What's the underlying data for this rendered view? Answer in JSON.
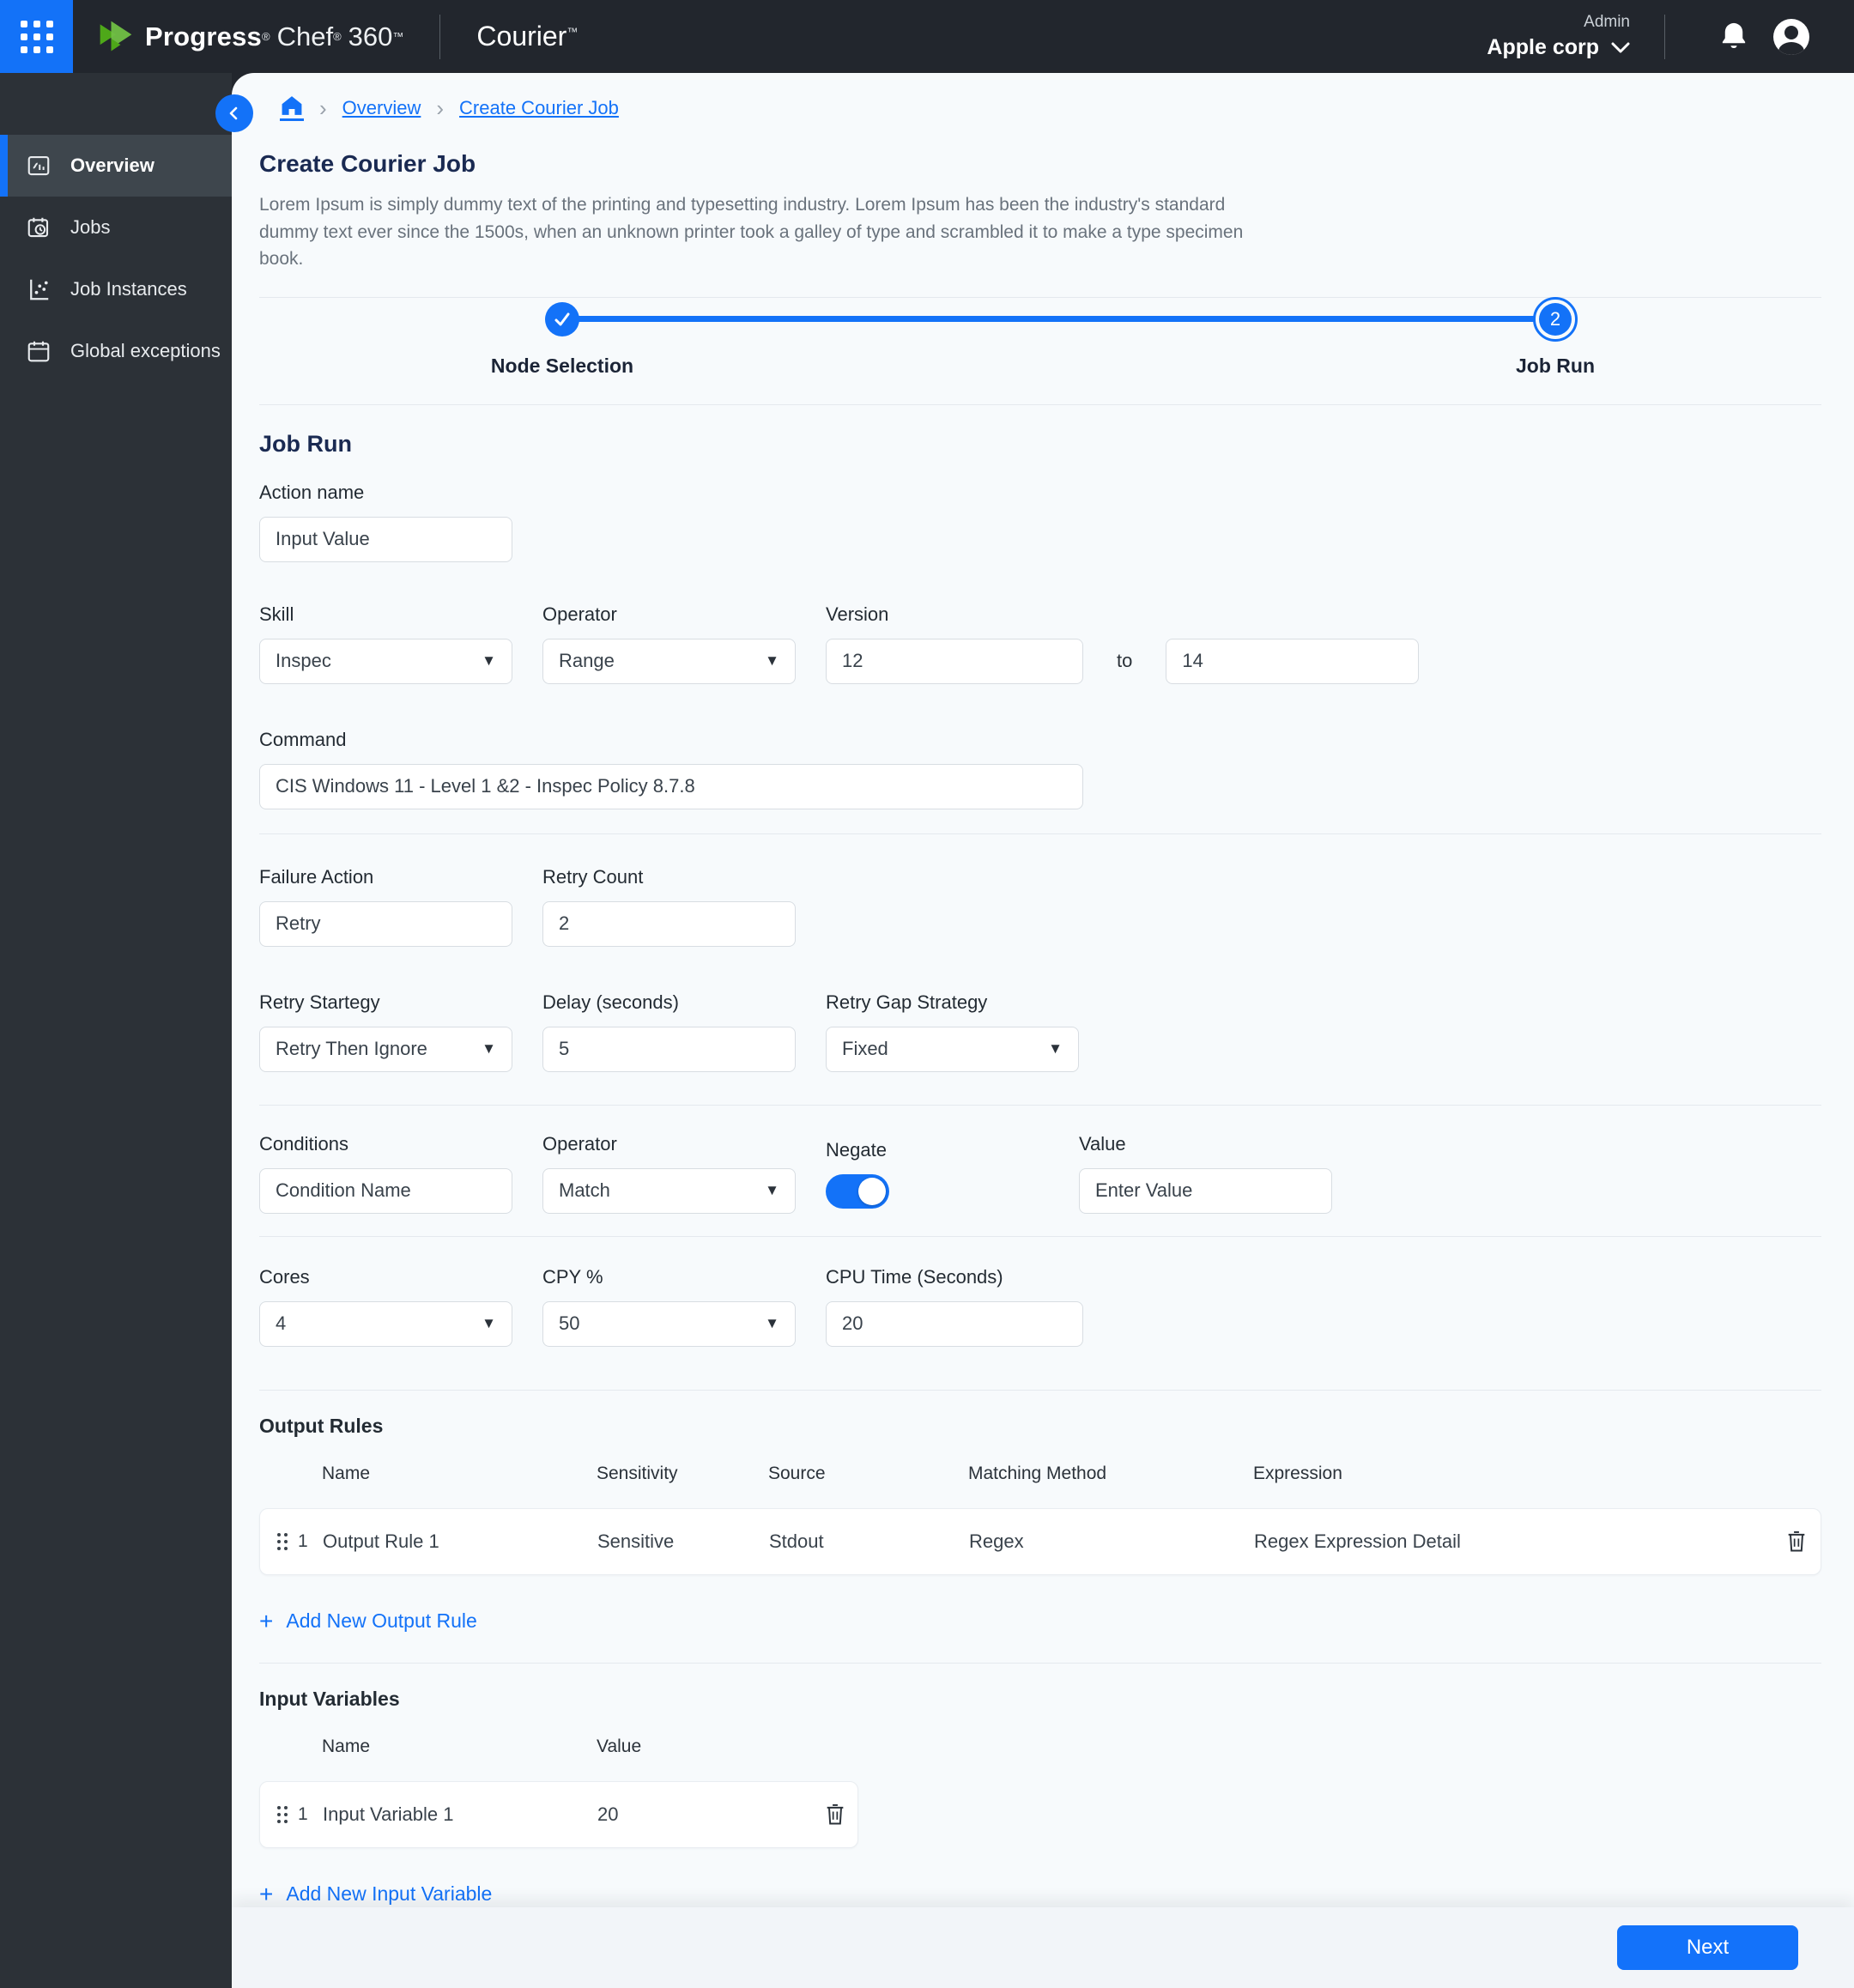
{
  "header": {
    "brand_progress": "Progress",
    "brand_reg": "®",
    "brand_chef": "Chef",
    "brand_360": "360",
    "brand_tm": "™",
    "product": "Courier",
    "product_tm": "™",
    "role_label": "Admin",
    "org_name": "Apple corp"
  },
  "sidebar": {
    "items": [
      {
        "label": "Overview"
      },
      {
        "label": "Jobs"
      },
      {
        "label": "Job Instances"
      },
      {
        "label": "Global exceptions"
      }
    ]
  },
  "breadcrumb": {
    "items": [
      "Overview",
      "Create Courier Job"
    ]
  },
  "page": {
    "title": "Create Courier Job",
    "description": "Lorem Ipsum is simply dummy text of the printing and typesetting industry. Lorem Ipsum has been the industry's standard dummy text ever since the 1500s, when an unknown printer took a galley of type and scrambled it to make a type specimen book."
  },
  "stepper": {
    "step1_label": "Node Selection",
    "step2_label": "Job Run",
    "step2_number": "2"
  },
  "form": {
    "section_title": "Job Run",
    "action_name": {
      "label": "Action name",
      "value": "Input Value"
    },
    "skill": {
      "label": "Skill",
      "value": "Inspec"
    },
    "operator": {
      "label": "Operator",
      "value": "Range"
    },
    "version": {
      "label": "Version",
      "from": "12",
      "to_label": "to",
      "to": "14"
    },
    "command": {
      "label": "Command",
      "value": "CIS Windows 11 - Level 1 &2 - Inspec Policy 8.7.8"
    },
    "failure_action": {
      "label": "Failure Action",
      "value": "Retry"
    },
    "retry_count": {
      "label": "Retry Count",
      "value": "2"
    },
    "retry_strategy": {
      "label": "Retry Startegy",
      "value": "Retry Then Ignore"
    },
    "delay": {
      "label": "Delay (seconds)",
      "value": "5"
    },
    "retry_gap_strategy": {
      "label": "Retry Gap Strategy",
      "value": "Fixed"
    },
    "conditions": {
      "label": "Conditions",
      "value": "Condition Name"
    },
    "condition_operator": {
      "label": "Operator",
      "value": "Match"
    },
    "negate": {
      "label": "Negate"
    },
    "value_field": {
      "label": "Value",
      "value": "Enter Value"
    },
    "cores": {
      "label": "Cores",
      "value": "4"
    },
    "cpy": {
      "label": "CPY %",
      "value": "50"
    },
    "cpu_time": {
      "label": "CPU Time (Seconds)",
      "value": "20"
    }
  },
  "output_rules": {
    "title": "Output Rules",
    "columns": [
      "Name",
      "Sensitivity",
      "Source",
      "Matching Method",
      "Expression"
    ],
    "rows": [
      {
        "index": "1",
        "name": "Output Rule 1",
        "sensitivity": "Sensitive",
        "source": "Stdout",
        "matching_method": "Regex",
        "expression": "Regex Expression Detail"
      }
    ],
    "add_label": "Add New Output Rule"
  },
  "input_variables": {
    "title": "Input Variables",
    "columns": [
      "Name",
      "Value"
    ],
    "rows": [
      {
        "index": "1",
        "name": "Input Variable 1",
        "value": "20"
      }
    ],
    "add_label": "Add New Input Variable"
  },
  "footer": {
    "next_label": "Next"
  },
  "colors": {
    "accent": "#1372F8",
    "header_bg": "#22262D",
    "sidebar_bg": "#2C3137",
    "content_bg": "#F7FAFC"
  }
}
